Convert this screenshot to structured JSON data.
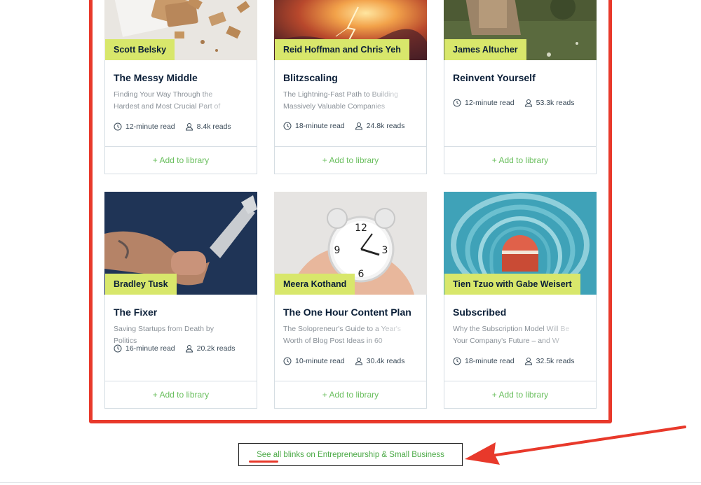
{
  "accent_color": "#6abf5e",
  "tag_color": "#d8e76b",
  "highlight_color": "#e8392b",
  "add_label": "+ Add to library",
  "cards": [
    {
      "author": "Scott Belsky",
      "title": "The Messy Middle",
      "subtitle": "Finding Your Way Through the Hardest and Most Crucial Part of",
      "read_time": "12-minute read",
      "reads": "8.4k reads",
      "image": "crackers-photo"
    },
    {
      "author": "Reid Hoffman and Chris Yeh",
      "title": "Blitzscaling",
      "subtitle": "The Lightning-Fast Path to Building Massively Valuable Companies",
      "read_time": "18-minute read",
      "reads": "24.8k reads",
      "image": "lightning-sky-photo"
    },
    {
      "author": "James Altucher",
      "title": "Reinvent Yourself",
      "subtitle": "",
      "read_time": "12-minute read",
      "reads": "53.3k reads",
      "image": "person-in-grass-photo"
    },
    {
      "author": "Bradley Tusk",
      "title": "The Fixer",
      "subtitle": "Saving Startups from Death by Politics",
      "read_time": "16-minute read",
      "reads": "20.2k reads",
      "image": "wrench-arm-photo"
    },
    {
      "author": "Meera Kothand",
      "title": "The One Hour Content Plan",
      "subtitle": "The Solopreneur's Guide to a Year's Worth of Blog Post Ideas in 60",
      "read_time": "10-minute read",
      "reads": "30.4k reads",
      "image": "alarm-clock-photo"
    },
    {
      "author": "Tien Tzuo with Gabe Weisert",
      "title": "Subscribed",
      "subtitle": "Why the Subscription Model Will Be Your Company's Future – and W",
      "read_time": "18-minute read",
      "reads": "32.5k reads",
      "image": "arches-photo"
    }
  ],
  "see_all_label": "See all blinks on Entrepreneurship & Small Business"
}
